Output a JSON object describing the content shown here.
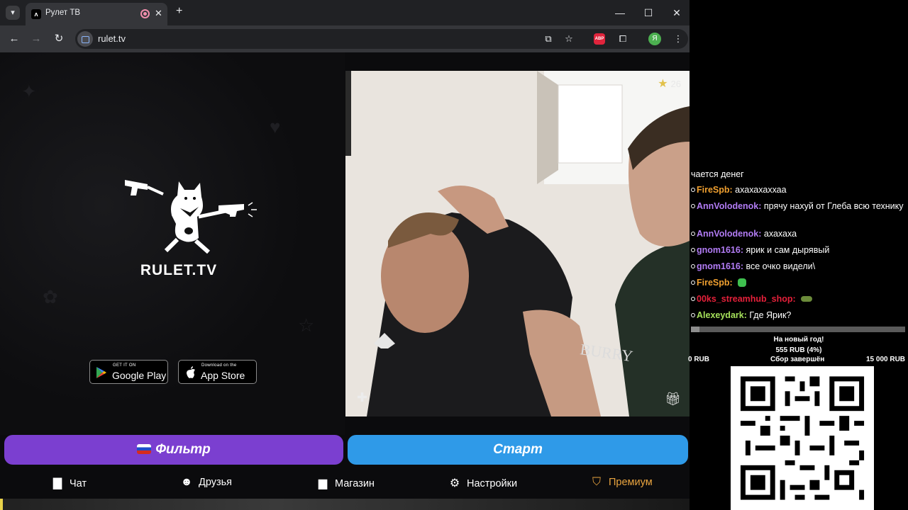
{
  "browser": {
    "tab_title": "Рулет ТВ",
    "favicon_glyph": "ᴧ",
    "url": "rulet.tv",
    "profile_initial": "Я",
    "abp_label": "ABP"
  },
  "site": {
    "logo_text": "RULET.TV",
    "google_play": {
      "small": "GET IT ON",
      "big": "Google Play"
    },
    "app_store": {
      "small": "Download on the",
      "big": "App Store"
    },
    "stars_count": "26",
    "filter_button": "Фильтр",
    "start_button": "Старт",
    "nav": [
      {
        "label": "Чат",
        "icon": "chat-icon"
      },
      {
        "label": "Друзья",
        "icon": "friends-icon"
      },
      {
        "label": "Магазин",
        "icon": "shop-bag-icon"
      },
      {
        "label": "Настройки",
        "icon": "gear-icon"
      },
      {
        "label": "Премиум",
        "icon": "premium-tag-icon"
      }
    ],
    "colors": {
      "filter_bg": "#7b3fd0",
      "start_bg": "#2f9ae8",
      "premium": "#e9a43f"
    }
  },
  "overlay": {
    "chat": [
      {
        "nick": "",
        "text": "чается денег",
        "color": "#ffffff"
      },
      {
        "nick": "FireSpb:",
        "text": " ахахахаххаа",
        "color": "#f0a030"
      },
      {
        "nick": "AnnVolodenok:",
        "text": " прячу нахуй от Глеба всю технику",
        "color": "#b27cf5"
      },
      {
        "nick": "AnnVolodenok:",
        "text": " ахахаха",
        "color": "#b27cf5"
      },
      {
        "nick": "gnom1616:",
        "text": " ярик и сам дырявый",
        "color": "#b27cf5"
      },
      {
        "nick": "gnom1616:",
        "text": " все очко видели\\",
        "color": "#b27cf5"
      },
      {
        "nick": "FireSpb:",
        "text": "",
        "color": "#f0a030"
      },
      {
        "nick": "00ks_streamhub_shop:",
        "text": "",
        "color": "#e5203a"
      },
      {
        "nick": "Alexeydark:",
        "text": " Где Ярик?",
        "color": "#a5e05a"
      }
    ],
    "goal": {
      "title": "На новый год!",
      "collected": "555 RUB (4%)",
      "min": "0 RUB",
      "status": "Сбор завершён",
      "max": "15 000 RUB",
      "progress": 0.04
    }
  }
}
